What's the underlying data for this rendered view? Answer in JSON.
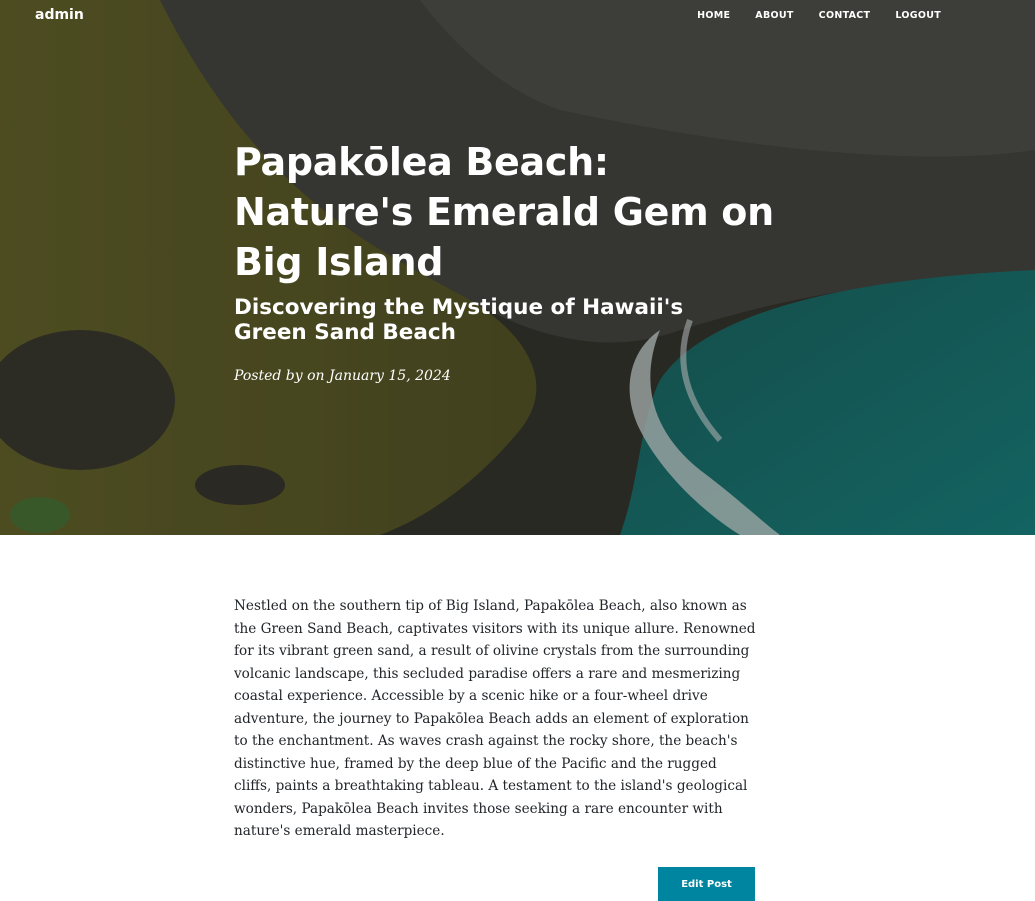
{
  "navbar": {
    "brand": "admin",
    "links": [
      "HOME",
      "ABOUT",
      "CONTACT",
      "LOGOUT"
    ]
  },
  "post": {
    "title": "Papakōlea Beach: Nature's Emerald Gem on Big Island",
    "subtitle": "Discovering the Mystique of Hawaii's Green Sand Beach",
    "meta": "Posted by on January 15, 2024",
    "body": "Nestled on the southern tip of Big Island, Papakōlea Beach, also known as the Green Sand Beach, captivates visitors with its unique allure. Renowned for its vibrant green sand, a result of olivine crystals from the surrounding volcanic landscape, this secluded paradise offers a rare and mesmerizing coastal experience. Accessible by a scenic hike or a four-wheel drive adventure, the journey to Papakōlea Beach adds an element of exploration to the enchantment. As waves crash against the rocky shore, the beach's distinctive hue, framed by the deep blue of the Pacific and the rugged cliffs, paints a breathtaking tableau. A testament to the island's geological wonders, Papakōlea Beach invites those seeking a rare encounter with nature's emerald masterpiece."
  },
  "actions": {
    "edit_label": "Edit Post"
  },
  "colors": {
    "accent": "#0085a1",
    "text": "#212529"
  }
}
